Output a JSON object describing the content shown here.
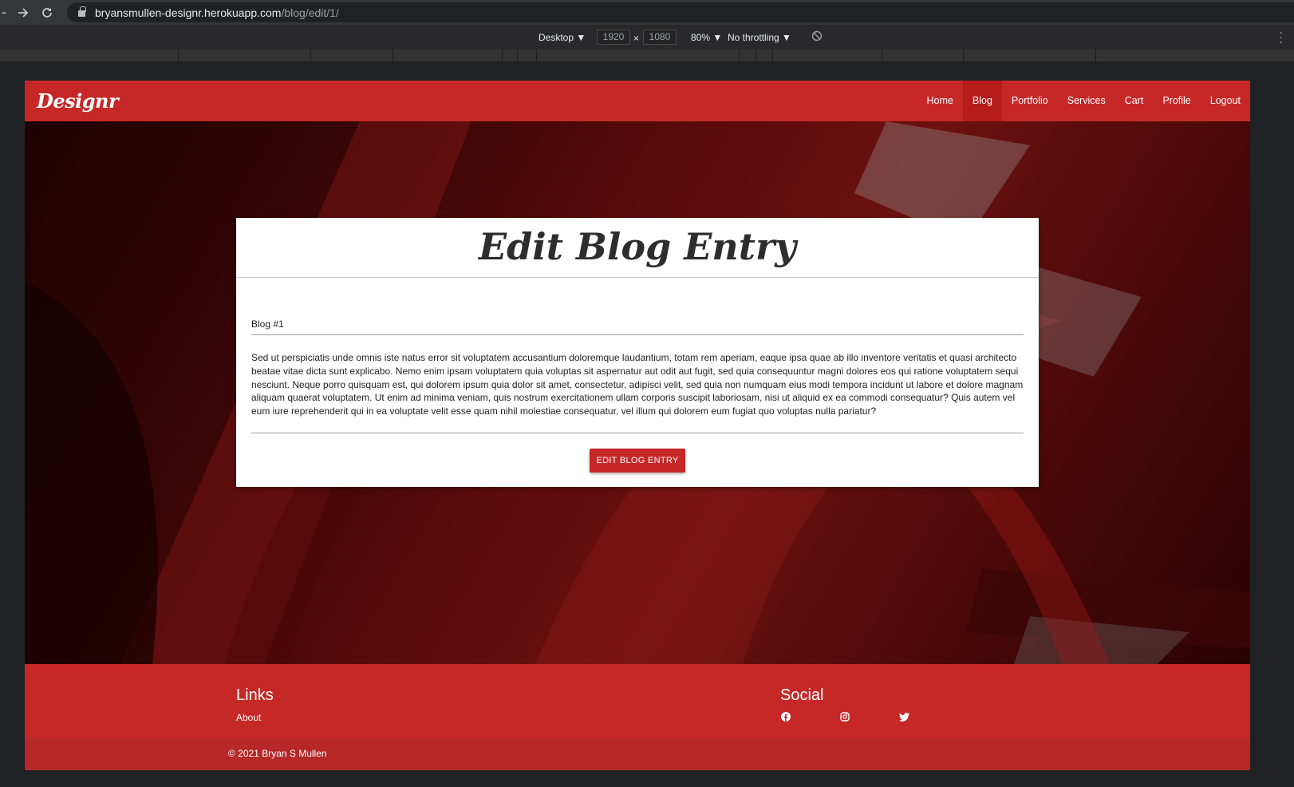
{
  "browser": {
    "url_host": "bryansmullen-designr.herokuapp.com",
    "url_path": "/blog/edit/1/"
  },
  "devtools": {
    "device": "Desktop ▼",
    "width": "1920",
    "times": "×",
    "height": "1080",
    "zoom": "80% ▼",
    "throttling": "No throttling ▼"
  },
  "site": {
    "brand": "Designr",
    "nav": [
      {
        "label": "Home",
        "active": false
      },
      {
        "label": "Blog",
        "active": true
      },
      {
        "label": "Portfolio",
        "active": false
      },
      {
        "label": "Services",
        "active": false
      },
      {
        "label": "Cart",
        "active": false
      },
      {
        "label": "Profile",
        "active": false
      },
      {
        "label": "Logout",
        "active": false
      }
    ]
  },
  "form": {
    "heading": "Edit Blog Entry",
    "title_value": "Blog #1",
    "body_value": "Sed ut perspiciatis unde omnis iste natus error sit voluptatem accusantium doloremque laudantium, totam rem aperiam, eaque ipsa quae ab illo inventore veritatis et quasi architecto beatae vitae dicta sunt explicabo. Nemo enim ipsam voluptatem quia voluptas sit aspernatur aut odit aut fugit, sed quia consequuntur magni dolores eos qui ratione voluptatem sequi nesciunt. Neque porro quisquam est, qui dolorem ipsum quia dolor sit amet, consectetur, adipisci velit, sed quia non numquam eius modi tempora incidunt ut labore et dolore magnam aliquam quaerat voluptatem. Ut enim ad minima veniam, quis nostrum exercitationem ullam corporis suscipit laboriosam, nisi ut aliquid ex ea commodi consequatur? Quis autem vel eum iure reprehenderit qui in ea voluptate velit esse quam nihil molestiae consequatur, vel illum qui dolorem eum fugiat quo voluptas nulla pariatur?",
    "submit_label": "EDIT BLOG ENTRY"
  },
  "footer": {
    "links_heading": "Links",
    "about_label": "About",
    "social_heading": "Social",
    "social_icons": [
      "facebook-icon",
      "instagram-icon",
      "twitter-icon"
    ],
    "copyright": "© 2021 Bryan S Mullen"
  },
  "colors": {
    "brand_red": "#c62828",
    "brand_red_dark": "#b71c1c"
  }
}
